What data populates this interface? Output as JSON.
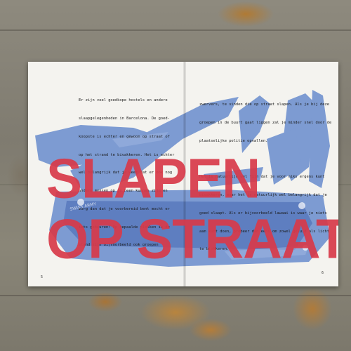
{
  "headline": {
    "line1": "SLAPEN",
    "line2": "OP STRAAT"
  },
  "body": {
    "left_lines": [
      "Er zijn veel goedkope hostels en andere",
      "slaapgelegenheden in Barcelona. De goed-",
      "koopste is echter en gewoon op straat of",
      "op het strand te bivakkeren. Het is echter",
      "wel belangrijk dat je weet dat er ook nog",
      "andere mensen op je heen kunnen zijn en",
      "zorg dan dat je voorbereid bent mocht er",
      "iets gebeuren! Op bepaalde plekken in de",
      "stand zijn bijvoorbeeld ook groepen"
    ],
    "right_lines": [
      "zwervers, te vinden die op straat slapen. Als je bij deze",
      "groepen in de buurt gaat liggen zal je minder snel door de",
      "plaatselijke politie opvallen.",
      "",
      "Het is natuurlijk wel fijn dat je voor niks ergens kunt",
      "bivakkeren, maar het is natuurlijk wel belangrijk dat je",
      "goed slaapt. Als er bijvoorbeeld lawaai is waar je niets",
      "aan kunt doen, probeer dan eens om zowel geluid als licht",
      "te blokkeren."
    ]
  },
  "page_numbers": {
    "left": "5",
    "right": "6"
  },
  "colors": {
    "headline_red": "#d83a4a",
    "knife_blue": "#5b7fc4",
    "paper": "#f4f3ef",
    "table": "#8a8577"
  },
  "illustration": {
    "subject": "swiss-army-knife-icon",
    "tool_text": "SWISS ARMY"
  }
}
